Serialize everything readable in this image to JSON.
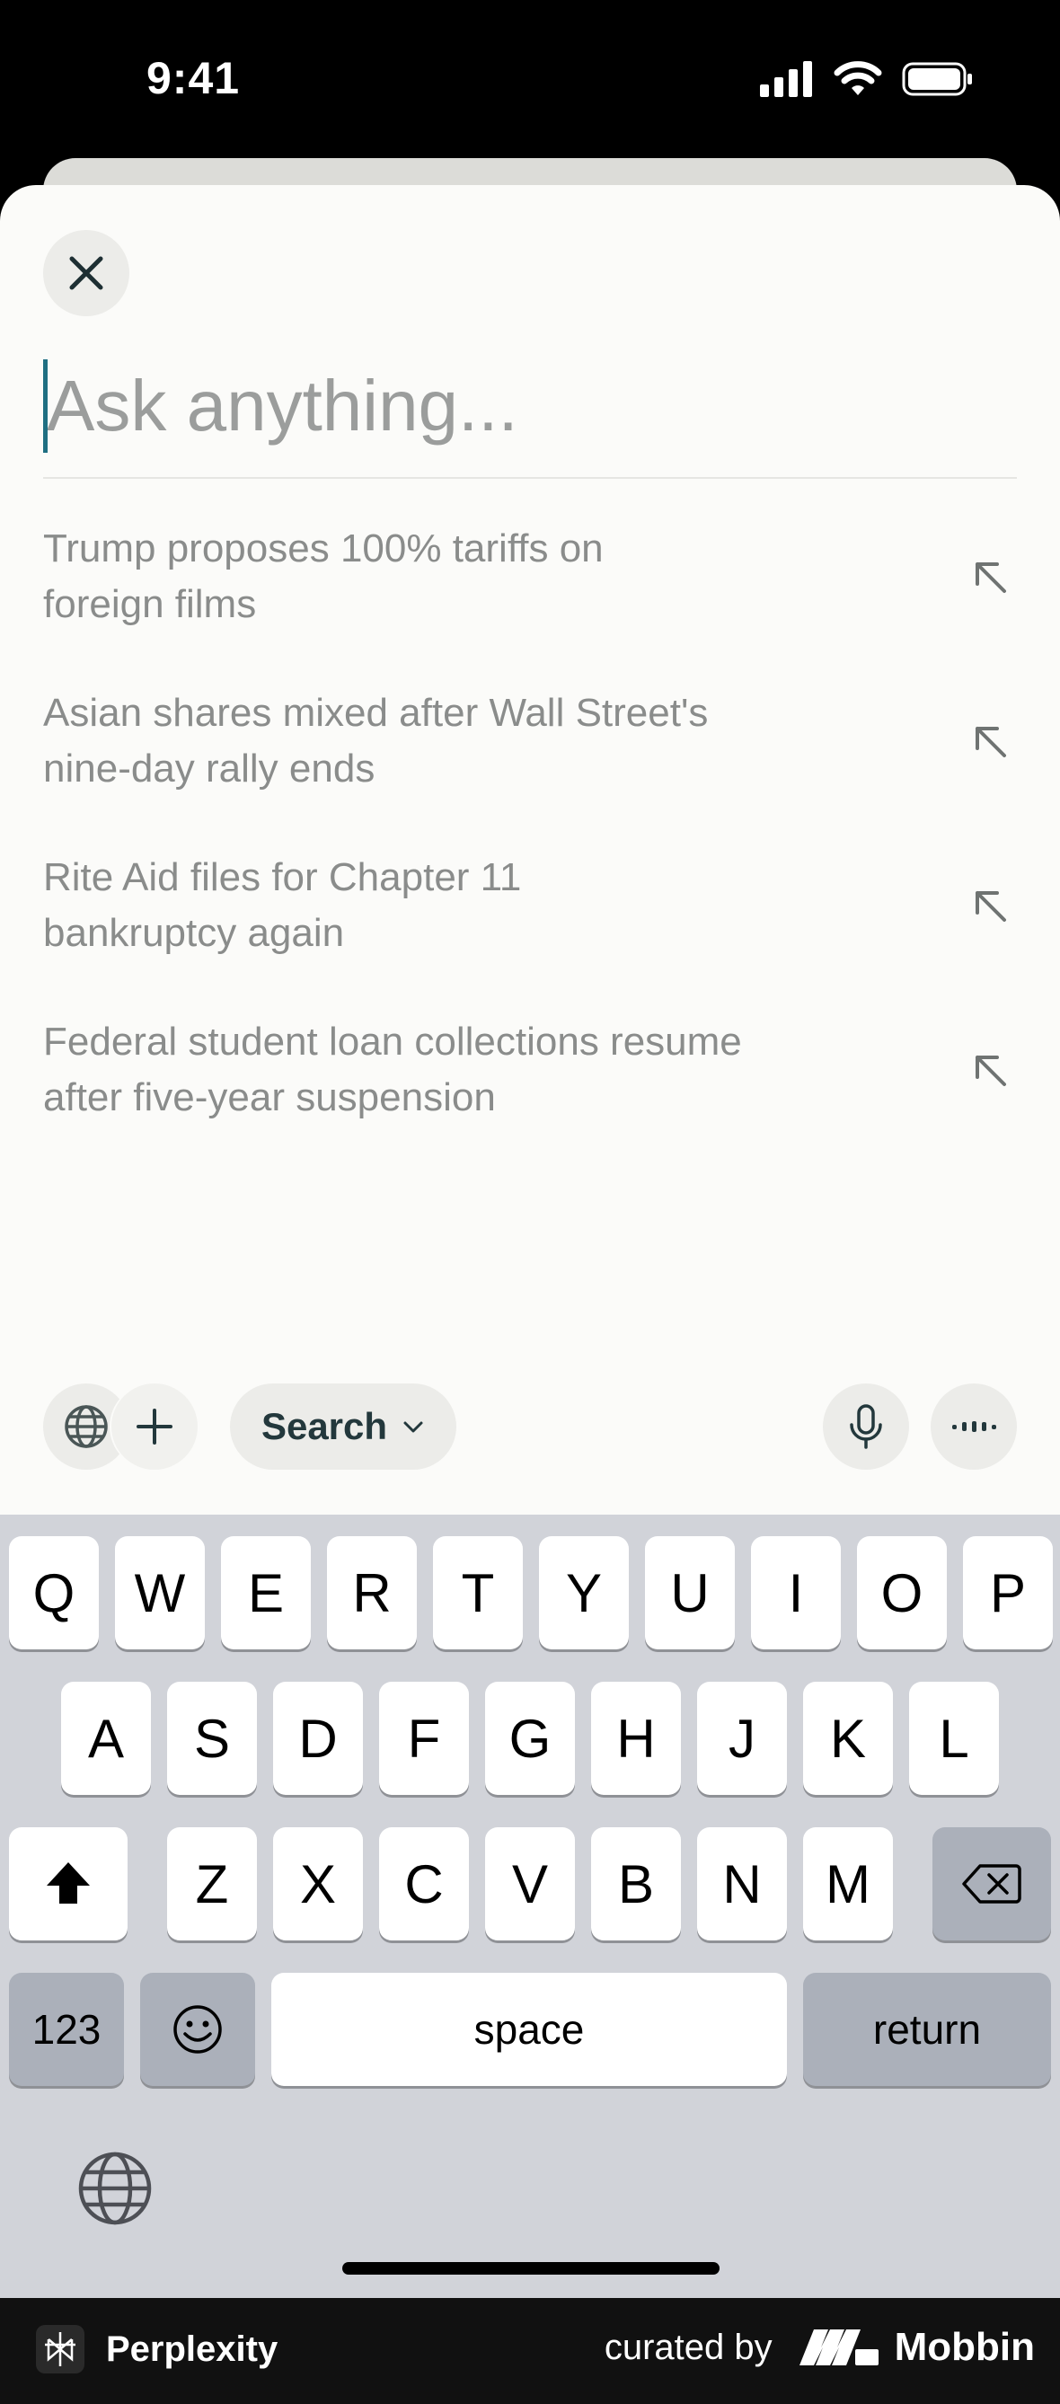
{
  "status_bar": {
    "time": "9:41"
  },
  "search": {
    "placeholder": "Ask anything..."
  },
  "suggestions": [
    {
      "line1": "Trump proposes 100% tariffs on",
      "line2": "foreign films"
    },
    {
      "line1": "Asian shares mixed after Wall Street's",
      "line2": "nine-day rally ends"
    },
    {
      "line1": "Rite Aid files for Chapter 11",
      "line2": "bankruptcy again"
    },
    {
      "line1": "Federal student loan collections resume",
      "line2": "after five-year suspension"
    }
  ],
  "toolbar": {
    "mode_label": "Search"
  },
  "keyboard": {
    "row1": [
      "Q",
      "W",
      "E",
      "R",
      "T",
      "Y",
      "U",
      "I",
      "O",
      "P"
    ],
    "row2": [
      "A",
      "S",
      "D",
      "F",
      "G",
      "H",
      "J",
      "K",
      "L"
    ],
    "row3": [
      "Z",
      "X",
      "C",
      "V",
      "B",
      "N",
      "M"
    ],
    "numbers_label": "123",
    "space_label": "space",
    "return_label": "return"
  },
  "footer": {
    "app_name": "Perplexity",
    "curated_by": "curated by",
    "brand": "Mobbin"
  },
  "colors": {
    "accent": "#1f6f82",
    "sheet": "#fbfbf9",
    "keyboard": "#d1d3d9"
  }
}
